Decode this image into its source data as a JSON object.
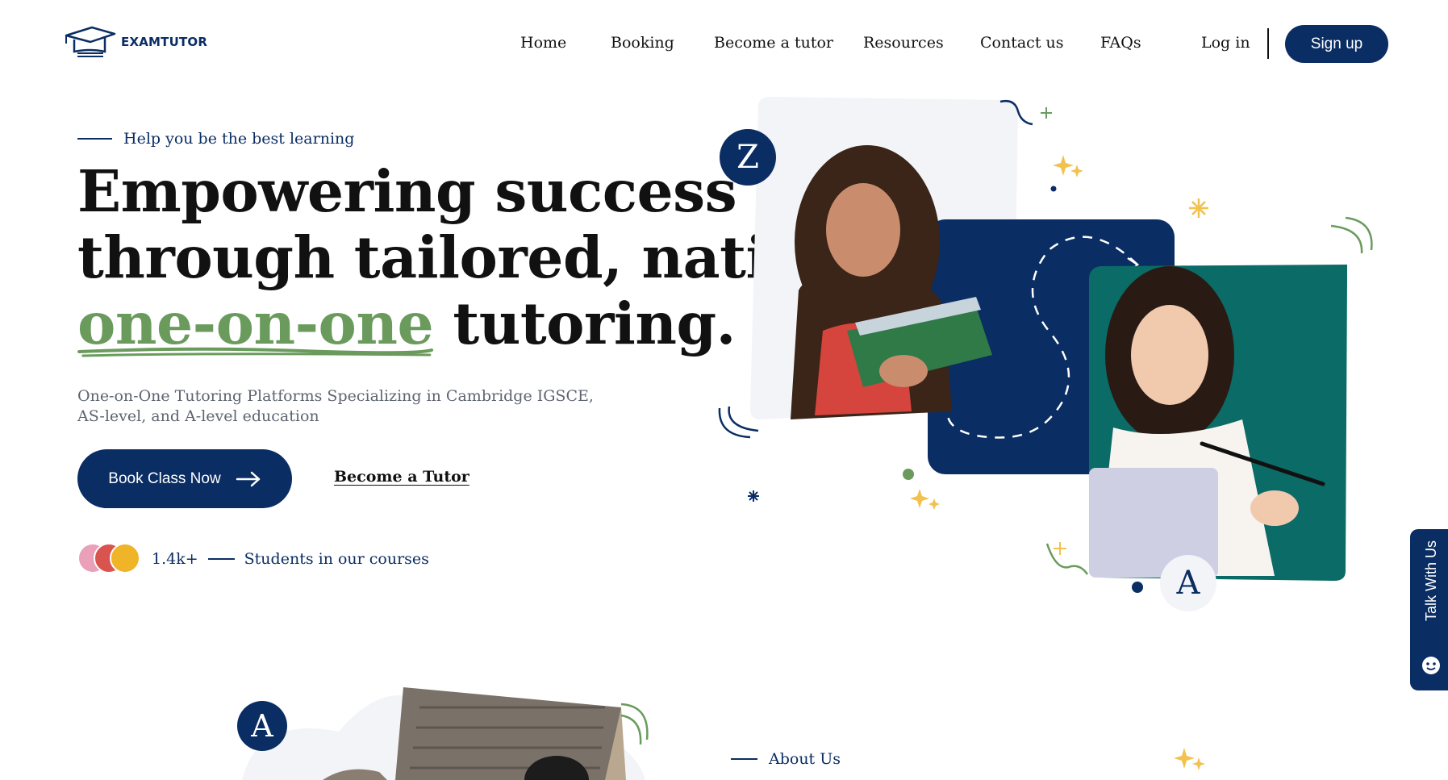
{
  "brand": {
    "name": "EXAMTUTOR"
  },
  "nav": {
    "items": [
      "Home",
      "Booking",
      "Become a tutor",
      "Resources",
      "Contact us",
      "FAQs"
    ],
    "login_label": "Log in",
    "signup_label": "Sign up"
  },
  "hero": {
    "eyebrow": "Help you be the best learning",
    "headline_line1": "Empowering success",
    "headline_line2": "through tailored, native,",
    "headline_highlight": "one-on-one",
    "headline_end": " tutoring.",
    "subcopy": "One-on-One Tutoring Platforms Specializing in Cambridge IGSCE, AS-level, and A-level education",
    "cta_primary": "Book Class Now",
    "cta_secondary": "Become a Tutor",
    "students_count": "1.4k+",
    "students_label": "Students in our courses",
    "badge_top": "Z",
    "badge_bottom": "A"
  },
  "talk_widget": {
    "label": "Talk With Us",
    "icon": "chat-face-icon"
  },
  "about": {
    "badge": "A",
    "eyebrow": "About Us"
  },
  "colors": {
    "navy": "#0a2d63",
    "green_accent": "#6a9b5d",
    "teal_card": "#0b6b66",
    "yellow_sparkle": "#f2c14e",
    "light_card": "#f3f4f8"
  }
}
